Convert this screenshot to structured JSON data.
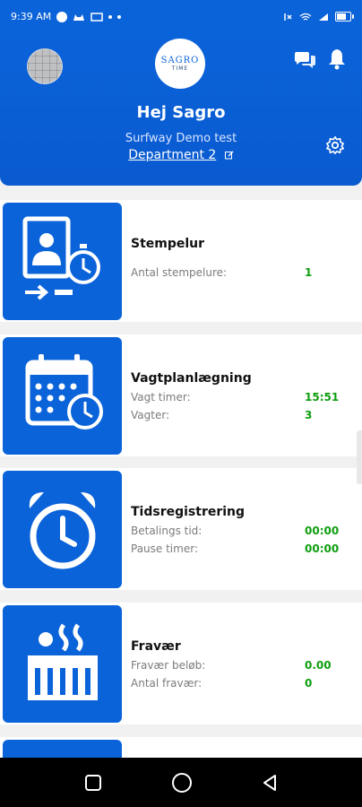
{
  "status_bar": {
    "time": "9:39 AM"
  },
  "header": {
    "logo_name": "SAGRO",
    "logo_sub": "TIME",
    "greeting": "Hej Sagro",
    "company": "Surfway Demo test",
    "department": "Department 2"
  },
  "cards": [
    {
      "title": "Stempelur",
      "rows": [
        {
          "label": "Antal stempelure:",
          "value": "1"
        }
      ]
    },
    {
      "title": "Vagtplanlægning",
      "rows": [
        {
          "label": "Vagt timer:",
          "value": "15:51"
        },
        {
          "label": "Vagter:",
          "value": "3"
        }
      ]
    },
    {
      "title": "Tidsregistrering",
      "rows": [
        {
          "label": "Betalings tid:",
          "value": "00:00"
        },
        {
          "label": "Pause timer:",
          "value": "00:00"
        }
      ]
    },
    {
      "title": "Fravær",
      "rows": [
        {
          "label": "Fravær beløb:",
          "value": "0.00"
        },
        {
          "label": "Antal fravær:",
          "value": "0"
        }
      ]
    }
  ],
  "colors": {
    "primary": "#0b63d9",
    "value_green": "#0e9e0e",
    "background": "#f1f1f1"
  },
  "icons": {
    "card_0": "person-clock-icon",
    "card_1": "calendar-clock-icon",
    "card_2": "alarm-clock-icon",
    "card_3": "heat-absence-icon"
  }
}
